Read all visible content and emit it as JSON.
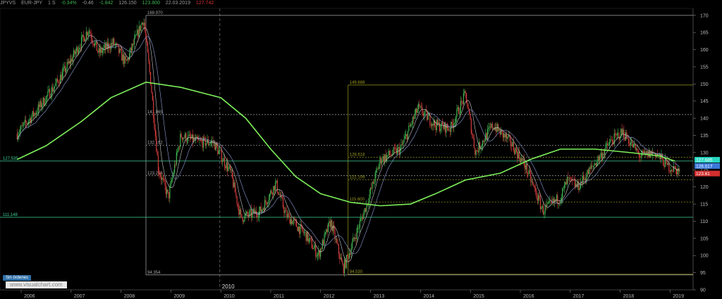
{
  "header": {
    "symbol": "JPYVS",
    "instrument": "EUR-JPY",
    "timeframe": "1 S",
    "change_pct_label": "-0.34%",
    "change_label": "-0.46",
    "change_abs_label": "-1.842",
    "open_label": "126.150",
    "high_label": "123.800",
    "date_label": "22.03.2019",
    "last_label": "127.742"
  },
  "ui": {
    "orders_badge": "Sin órdenes",
    "watermark": "www.visualchart.com",
    "cursor_year_label": "2010"
  },
  "colors": {
    "background": "#000000",
    "candle_up": "#3fb34f",
    "candle_down": "#d33b3b",
    "sma_long": "#7df05a",
    "fib_grey": "#a9a9a9",
    "fib_olive": "#9a9a20",
    "horizontal_level": "#3fd39a",
    "price_badge_teal": "#2ad9c3",
    "price_badge_blue": "#3b78d8",
    "price_badge_red": "#d32f2f"
  },
  "chart_data": {
    "type": "candlestick",
    "x_axis": {
      "ticks": [
        "2006",
        "2007",
        "2008",
        "2009",
        "2010",
        "2011",
        "2012",
        "2013",
        "2014",
        "2015",
        "2016",
        "2017",
        "2018",
        "2019"
      ]
    },
    "y_axis": {
      "range": [
        90,
        172
      ],
      "ticks": [
        "90",
        "95",
        "100",
        "105",
        "110",
        "115",
        "120",
        "125",
        "130",
        "135",
        "140",
        "145",
        "150",
        "155",
        "160",
        "165",
        "170"
      ]
    },
    "price_path_yearly": [
      {
        "t": 2005.92,
        "v": 135.5
      },
      {
        "t": 2006.3,
        "v": 142
      },
      {
        "t": 2006.7,
        "v": 150
      },
      {
        "t": 2007.0,
        "v": 157
      },
      {
        "t": 2007.35,
        "v": 166
      },
      {
        "t": 2007.55,
        "v": 159
      },
      {
        "t": 2007.85,
        "v": 162
      },
      {
        "t": 2008.1,
        "v": 156
      },
      {
        "t": 2008.45,
        "v": 169
      },
      {
        "t": 2008.6,
        "v": 150
      },
      {
        "t": 2008.75,
        "v": 125
      },
      {
        "t": 2008.95,
        "v": 117
      },
      {
        "t": 2009.2,
        "v": 135
      },
      {
        "t": 2009.55,
        "v": 133
      },
      {
        "t": 2009.85,
        "v": 133
      },
      {
        "t": 2010.2,
        "v": 124
      },
      {
        "t": 2010.4,
        "v": 111
      },
      {
        "t": 2010.8,
        "v": 113
      },
      {
        "t": 2011.1,
        "v": 121
      },
      {
        "t": 2011.3,
        "v": 112
      },
      {
        "t": 2011.7,
        "v": 106
      },
      {
        "t": 2011.95,
        "v": 100
      },
      {
        "t": 2012.2,
        "v": 110
      },
      {
        "t": 2012.45,
        "v": 96
      },
      {
        "t": 2012.6,
        "v": 102
      },
      {
        "t": 2012.9,
        "v": 114
      },
      {
        "t": 2013.2,
        "v": 128
      },
      {
        "t": 2013.6,
        "v": 131
      },
      {
        "t": 2013.95,
        "v": 143
      },
      {
        "t": 2014.3,
        "v": 138
      },
      {
        "t": 2014.6,
        "v": 137
      },
      {
        "t": 2014.9,
        "v": 147
      },
      {
        "t": 2015.1,
        "v": 130
      },
      {
        "t": 2015.45,
        "v": 138
      },
      {
        "t": 2015.8,
        "v": 133
      },
      {
        "t": 2016.1,
        "v": 126
      },
      {
        "t": 2016.45,
        "v": 113
      },
      {
        "t": 2016.8,
        "v": 117
      },
      {
        "t": 2016.95,
        "v": 122
      },
      {
        "t": 2017.15,
        "v": 120
      },
      {
        "t": 2017.45,
        "v": 126
      },
      {
        "t": 2017.8,
        "v": 133
      },
      {
        "t": 2018.05,
        "v": 136
      },
      {
        "t": 2018.4,
        "v": 129
      },
      {
        "t": 2018.7,
        "v": 130
      },
      {
        "t": 2018.95,
        "v": 126
      },
      {
        "t": 2019.2,
        "v": 124.5
      }
    ],
    "sma_long": [
      {
        "t": 2005.92,
        "v": 128
      },
      {
        "t": 2006.5,
        "v": 132
      },
      {
        "t": 2007.2,
        "v": 139
      },
      {
        "t": 2007.8,
        "v": 146
      },
      {
        "t": 2008.5,
        "v": 150.5
      },
      {
        "t": 2009.2,
        "v": 149
      },
      {
        "t": 2010.0,
        "v": 146
      },
      {
        "t": 2010.5,
        "v": 140
      },
      {
        "t": 2011.0,
        "v": 131
      },
      {
        "t": 2011.5,
        "v": 123
      },
      {
        "t": 2012.0,
        "v": 118
      },
      {
        "t": 2012.6,
        "v": 115.5
      },
      {
        "t": 2013.2,
        "v": 114.5
      },
      {
        "t": 2013.8,
        "v": 115
      },
      {
        "t": 2014.3,
        "v": 118
      },
      {
        "t": 2014.9,
        "v": 122
      },
      {
        "t": 2015.6,
        "v": 124
      },
      {
        "t": 2016.2,
        "v": 128
      },
      {
        "t": 2016.8,
        "v": 131
      },
      {
        "t": 2017.5,
        "v": 131
      },
      {
        "t": 2018.2,
        "v": 130
      },
      {
        "t": 2018.8,
        "v": 129
      },
      {
        "t": 2019.1,
        "v": 127.5
      }
    ],
    "horizontal_levels": [
      {
        "value": 127.535,
        "label": "127,535"
      },
      {
        "value": 111.148,
        "label": "111,148"
      }
    ],
    "fibonacci": [
      {
        "color": "grey",
        "x_start": 2008.5,
        "levels": [
          {
            "value": 169.97,
            "label": "169.970"
          },
          {
            "value": 141.065,
            "label": "141.065"
          },
          {
            "value": 132.162,
            "label": "132.162"
          },
          {
            "value": 123.258,
            "label": "123.258"
          },
          {
            "value": 94.354,
            "label": "94.354"
          }
        ]
      },
      {
        "color": "olive",
        "x_start": 2012.55,
        "levels": [
          {
            "value": 149.688,
            "label": "149.688"
          },
          {
            "value": 128.618,
            "label": "128.618"
          },
          {
            "value": 122.109,
            "label": "122.109"
          },
          {
            "value": 115.6,
            "label": "115.600"
          },
          {
            "value": 94.53,
            "label": "94.530"
          }
        ]
      }
    ],
    "cursor_x": 2009.98,
    "price_badges": [
      {
        "value": 127.9,
        "label": "127.685",
        "color": "teal"
      },
      {
        "value": 126.1,
        "label": "126.017",
        "color": "blue"
      },
      {
        "value": 123.9,
        "label": "123.81",
        "color": "red"
      }
    ]
  }
}
